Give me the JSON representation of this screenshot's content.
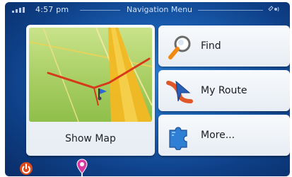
{
  "status": {
    "time": "4:57 pm",
    "title": "Navigation Menu"
  },
  "tiles": {
    "show_map": "Show Map",
    "find": "Find",
    "my_route": "My Route",
    "more": "More..."
  },
  "icons": {
    "status": "signal-icon",
    "top_right": "satellite-icon",
    "find": "magnifier-icon",
    "route": "route-arrow-icon",
    "more": "puzzle-icon",
    "power": "power-icon",
    "pin": "pin-icon"
  },
  "colors": {
    "background": "#1a5fb3",
    "tile": "#f2f5f9",
    "route_red": "#d63a1a",
    "accent_orange": "#f08a12"
  }
}
